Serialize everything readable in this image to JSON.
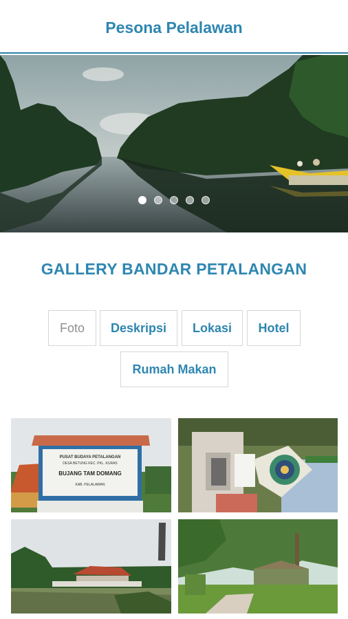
{
  "app": {
    "title": "Pesona Pelalawan"
  },
  "carousel": {
    "slide_count": 5,
    "active_index": 0
  },
  "gallery": {
    "title": "GALLERY BANDAR PETALANGAN"
  },
  "tabs": [
    {
      "label": "Foto",
      "active": true
    },
    {
      "label": "Deskripsi",
      "active": false
    },
    {
      "label": "Lokasi",
      "active": false
    },
    {
      "label": "Hotel",
      "active": false
    },
    {
      "label": "Rumah Makan",
      "active": false
    }
  ],
  "photos": {
    "sign": {
      "line1": "PUSAT BUDAYA PETALANGAN",
      "line2": "DESA BETUNG KEC. PKL. KURAS",
      "line3": "BUJANG TAM DOMANG",
      "line4": "KAB. PELALAWAN"
    }
  }
}
